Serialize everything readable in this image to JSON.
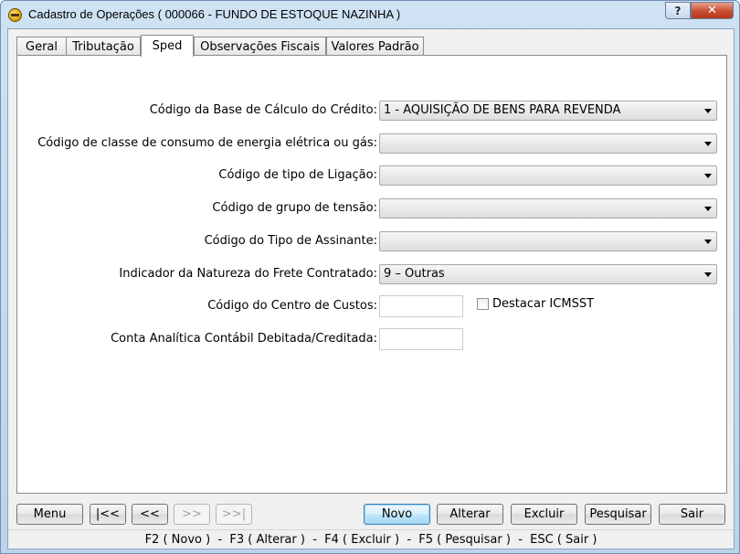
{
  "window": {
    "title": "Cadastro de Operações ( 000066 - FUNDO DE ESTOQUE NAZINHA )",
    "help_label": "?",
    "close_label": "✕"
  },
  "tabs": [
    {
      "label": "Geral"
    },
    {
      "label": "Tributação"
    },
    {
      "label": "Sped"
    },
    {
      "label": "Observações Fiscais"
    },
    {
      "label": "Valores Padrão"
    }
  ],
  "active_tab": "Sped",
  "form": {
    "base_calculo": {
      "label": "Código da Base de Cálculo do Crédito:",
      "value": "1 - AQUISIÇÃO DE BENS PARA REVENDA"
    },
    "classe_consumo": {
      "label": "Código de classe de consumo de energia elétrica ou gás:",
      "value": ""
    },
    "tipo_ligacao": {
      "label": "Código de tipo de Ligação:",
      "value": ""
    },
    "grupo_tensao": {
      "label": "Código de grupo de tensão:",
      "value": ""
    },
    "tipo_assinante": {
      "label": "Código do Tipo de Assinante:",
      "value": ""
    },
    "natureza_frete": {
      "label": "Indicador da Natureza do Frete Contratado:",
      "value": "9 – Outras"
    },
    "centro_custos": {
      "label": "Código do Centro de Custos:",
      "value": ""
    },
    "destacar_icmsst": {
      "label": "Destacar ICMSST",
      "checked": false
    },
    "conta_analitica": {
      "label": "Conta Analítica Contábil Debitada/Creditada:",
      "value": ""
    }
  },
  "buttons": {
    "menu": "Menu",
    "first": "|<<",
    "prev": "<<",
    "next": ">>",
    "last": ">>|",
    "novo": "Novo",
    "alterar": "Alterar",
    "excluir": "Excluir",
    "pesquisar": "Pesquisar",
    "sair": "Sair"
  },
  "statusbar": "F2 ( Novo )  -  F3 ( Alterar )  -  F4 ( Excluir )  -  F5 ( Pesquisar )  -  ESC ( Sair )"
}
